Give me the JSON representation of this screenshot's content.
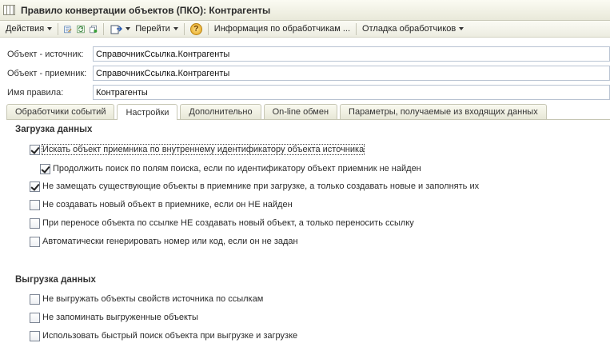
{
  "window": {
    "title": "Правило конвертации объектов (ПКО): Контрагенты"
  },
  "toolbar": {
    "actions_label": "Действия",
    "goto_label": "Перейти",
    "help_label": "?",
    "handlers_info_label": "Информация по обработчикам ...",
    "debug_handlers_label": "Отладка обработчиков"
  },
  "fields": {
    "source": {
      "label": "Объект - источник:",
      "value": "СправочникСсылка.Контрагенты"
    },
    "target": {
      "label": "Объект - приемник:",
      "value": "СправочникСсылка.Контрагенты"
    },
    "rule_name": {
      "label": "Имя правила:",
      "value": "Контрагенты"
    }
  },
  "tabs": [
    {
      "label": "Обработчики событий",
      "active": false
    },
    {
      "label": "Настройки",
      "active": true
    },
    {
      "label": "Дополнительно",
      "active": false
    },
    {
      "label": "On-line обмен",
      "active": false
    },
    {
      "label": "Параметры, получаемые из входящих данных",
      "active": false
    }
  ],
  "import_section": {
    "title": "Загрузка данных",
    "options": [
      {
        "label": "Искать объект приемника по внутреннему идентификатору объекта источника",
        "checked": true
      },
      {
        "label": "Продолжить поиск по полям поиска, если по идентификатору объект приемник не найден",
        "checked": true
      },
      {
        "label": "Не замещать существующие объекты в приемнике при загрузке, а только создавать новые и заполнять их",
        "checked": true
      },
      {
        "label": "Не создавать новый объект в приемнике, если он НЕ найден",
        "checked": false
      },
      {
        "label": "При переносе объекта по ссылке НЕ создавать новый объект, а только переносить ссылку",
        "checked": false
      },
      {
        "label": "Автоматически генерировать номер или код, если он не задан",
        "checked": false
      }
    ]
  },
  "export_section": {
    "title": "Выгрузка данных",
    "options": [
      {
        "label": "Не выгружать объекты свойств источника по ссылкам",
        "checked": false
      },
      {
        "label": "Не запоминать выгруженные объекты",
        "checked": false
      },
      {
        "label": "Использовать быстрый поиск объекта при выгрузке и загрузке",
        "checked": false
      }
    ]
  }
}
